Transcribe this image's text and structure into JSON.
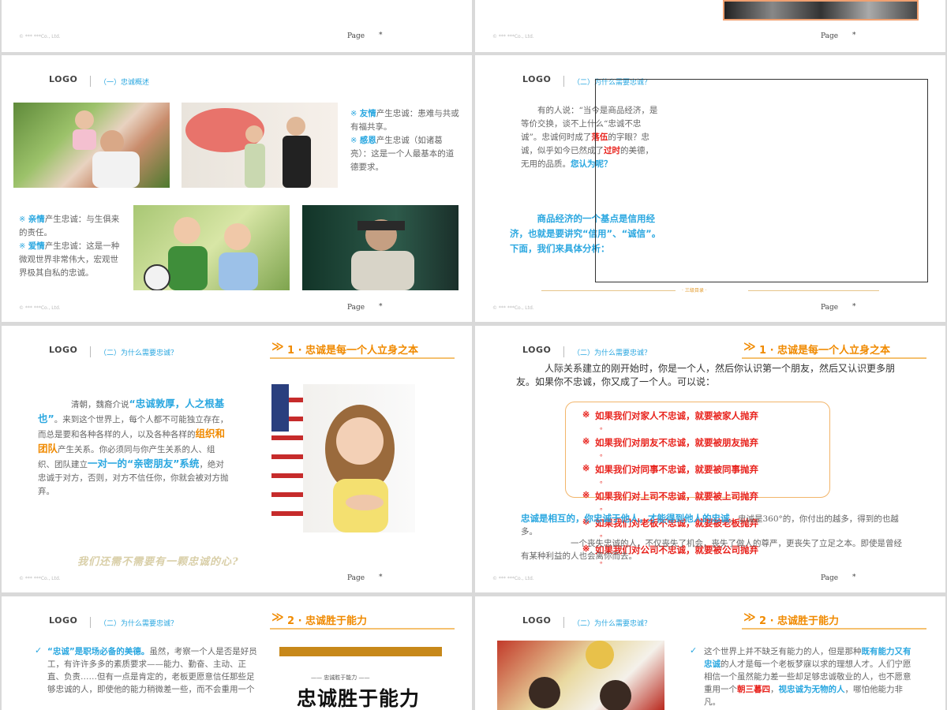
{
  "common": {
    "logo": "LOGO",
    "footer_left": "© *** ***Co., Ltd.",
    "page_label": "Page",
    "page_star": "*",
    "page_num": "　"
  },
  "section1": "（一）忠诚概述",
  "section2": "（二）为什么需要忠诚？",
  "slide3": {
    "right_items": [
      {
        "mark": "※",
        "hl": "友情",
        "text": "产生忠诚：患难与共或有福共享。"
      },
      {
        "mark": "※",
        "hl": "感恩",
        "text": "产生忠诚（如诸葛亮）：这是一个人最基本的道德要求。"
      }
    ],
    "left_items": [
      {
        "mark": "※",
        "hl": "亲情",
        "text": "产生忠诚：与生俱来的责任。"
      },
      {
        "mark": "※",
        "hl": "爱情",
        "text": "产生忠诚：这是一种微观世界非常伟大，宏观世界极其自私的忠诚。"
      }
    ]
  },
  "slide4": {
    "p1_a": "有的人说：“当今是商品经济，是等价交换，谈不上什么“忠诚不忠诚”。忠诚何时成了",
    "p1_hl1": "落伍",
    "p1_b": "的字眼？忠诚，似乎如今已然成了",
    "p1_hl2": "过时",
    "p1_c": "的美德，无用的品质。",
    "p1_q": "您认为呢？",
    "p2": "商品经济的一个基点是信用经济，也就是要讲究“信用”、“诚信”。下面，我们来具体分析：",
    "toc": "· 三级目录 ·"
  },
  "slide5": {
    "title": "1 · 忠诚是每一个人立身之本",
    "t1": "清朝，魏裔介说",
    "q1": "“忠诚敦厚，人之根基也”",
    "t2": "。来到这个世界上，每个人都不可能独立存在，而总是要和各种各样的人，以及各种各样的",
    "o1": "组织和团队",
    "t3": "产生关系。你必须同与你产生关系的人、组织、团队建立",
    "q2": "一对一的“亲密朋友”系统",
    "t4": "，绝对忠诚于对方，否则，对方不信任你，你就会被对方抛弃。",
    "banner": "我们还需不需要有一颗忠诚的心?"
  },
  "slide6": {
    "title": "1 · 忠诚是每一个人立身之本",
    "intro": "人际关系建立的刚开始时，你是一个人，然后你认识第一个朋友，然后又认识更多朋友。如果你不忠诚，你又成了一个人。可以说：",
    "list": [
      "如果我们对家人不忠诚，就要被家人抛弃",
      "如果我们对朋友不忠诚，就要被朋友抛弃",
      "如果我们对同事不忠诚，就要被同事抛弃",
      "如果我们对上司不忠诚，就要被上司抛弃",
      "如果我们对老板不忠诚，就要被老板抛弃",
      "如果我们对公司不忠诚，就要被公司抛弃"
    ],
    "bottom_hl": "忠诚是相互的，你忠诚于他人，才能得到他人的忠诚",
    "bottom_a": "。忠诚是360°的，你付出的越多，得到的也越多。",
    "bottom_b": "一个丧失忠诚的人，不仅丧失了机会，丧失了做人的尊严，更丧失了立足之本。即使是曾经有某种利益的人也会离你而去。"
  },
  "slide7": {
    "title": "2 · 忠诚胜于能力",
    "hl": "“忠诚”是职场必备的美德。",
    "text": "虽然，考察一个人是否是好员工，有许许多多的素质要求——能力、勤奋、主动、正直、负责……但有一点是肯定的，老板更愿意信任那些足够忠诚的人，即使他的能力稍微差一些，而不会重用一个",
    "book_title": "忠诚胜于能力",
    "book_sub": "—— 忠诚胜于能力 ——"
  },
  "slide8": {
    "title": "2 · 忠诚胜于能力",
    "t1": "这个世界上并不缺乏有能力的人，但是那种",
    "hl1": "既有能力又有忠诚",
    "t2": "的人才是每一个老板梦寐以求的理想人才。人们宁愿相信一个虽然能力差一些却足够忠诚敬业的人，也不愿意重用一个",
    "r1": "朝三暮四",
    "t3": "，",
    "hl2": "视忠诚为无物的人",
    "t4": "，哪怕他能力非凡。"
  }
}
